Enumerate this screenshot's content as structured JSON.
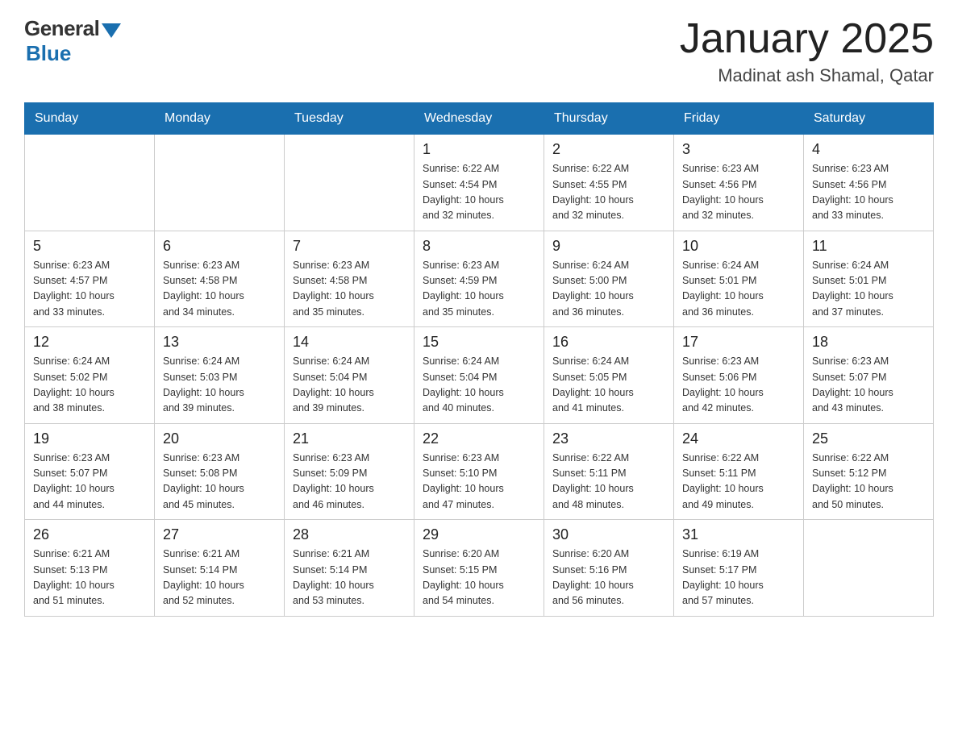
{
  "header": {
    "logo_general": "General",
    "logo_blue": "Blue",
    "month_title": "January 2025",
    "location": "Madinat ash Shamal, Qatar"
  },
  "weekdays": [
    "Sunday",
    "Monday",
    "Tuesday",
    "Wednesday",
    "Thursday",
    "Friday",
    "Saturday"
  ],
  "weeks": [
    [
      {
        "day": "",
        "info": ""
      },
      {
        "day": "",
        "info": ""
      },
      {
        "day": "",
        "info": ""
      },
      {
        "day": "1",
        "info": "Sunrise: 6:22 AM\nSunset: 4:54 PM\nDaylight: 10 hours\nand 32 minutes."
      },
      {
        "day": "2",
        "info": "Sunrise: 6:22 AM\nSunset: 4:55 PM\nDaylight: 10 hours\nand 32 minutes."
      },
      {
        "day": "3",
        "info": "Sunrise: 6:23 AM\nSunset: 4:56 PM\nDaylight: 10 hours\nand 32 minutes."
      },
      {
        "day": "4",
        "info": "Sunrise: 6:23 AM\nSunset: 4:56 PM\nDaylight: 10 hours\nand 33 minutes."
      }
    ],
    [
      {
        "day": "5",
        "info": "Sunrise: 6:23 AM\nSunset: 4:57 PM\nDaylight: 10 hours\nand 33 minutes."
      },
      {
        "day": "6",
        "info": "Sunrise: 6:23 AM\nSunset: 4:58 PM\nDaylight: 10 hours\nand 34 minutes."
      },
      {
        "day": "7",
        "info": "Sunrise: 6:23 AM\nSunset: 4:58 PM\nDaylight: 10 hours\nand 35 minutes."
      },
      {
        "day": "8",
        "info": "Sunrise: 6:23 AM\nSunset: 4:59 PM\nDaylight: 10 hours\nand 35 minutes."
      },
      {
        "day": "9",
        "info": "Sunrise: 6:24 AM\nSunset: 5:00 PM\nDaylight: 10 hours\nand 36 minutes."
      },
      {
        "day": "10",
        "info": "Sunrise: 6:24 AM\nSunset: 5:01 PM\nDaylight: 10 hours\nand 36 minutes."
      },
      {
        "day": "11",
        "info": "Sunrise: 6:24 AM\nSunset: 5:01 PM\nDaylight: 10 hours\nand 37 minutes."
      }
    ],
    [
      {
        "day": "12",
        "info": "Sunrise: 6:24 AM\nSunset: 5:02 PM\nDaylight: 10 hours\nand 38 minutes."
      },
      {
        "day": "13",
        "info": "Sunrise: 6:24 AM\nSunset: 5:03 PM\nDaylight: 10 hours\nand 39 minutes."
      },
      {
        "day": "14",
        "info": "Sunrise: 6:24 AM\nSunset: 5:04 PM\nDaylight: 10 hours\nand 39 minutes."
      },
      {
        "day": "15",
        "info": "Sunrise: 6:24 AM\nSunset: 5:04 PM\nDaylight: 10 hours\nand 40 minutes."
      },
      {
        "day": "16",
        "info": "Sunrise: 6:24 AM\nSunset: 5:05 PM\nDaylight: 10 hours\nand 41 minutes."
      },
      {
        "day": "17",
        "info": "Sunrise: 6:23 AM\nSunset: 5:06 PM\nDaylight: 10 hours\nand 42 minutes."
      },
      {
        "day": "18",
        "info": "Sunrise: 6:23 AM\nSunset: 5:07 PM\nDaylight: 10 hours\nand 43 minutes."
      }
    ],
    [
      {
        "day": "19",
        "info": "Sunrise: 6:23 AM\nSunset: 5:07 PM\nDaylight: 10 hours\nand 44 minutes."
      },
      {
        "day": "20",
        "info": "Sunrise: 6:23 AM\nSunset: 5:08 PM\nDaylight: 10 hours\nand 45 minutes."
      },
      {
        "day": "21",
        "info": "Sunrise: 6:23 AM\nSunset: 5:09 PM\nDaylight: 10 hours\nand 46 minutes."
      },
      {
        "day": "22",
        "info": "Sunrise: 6:23 AM\nSunset: 5:10 PM\nDaylight: 10 hours\nand 47 minutes."
      },
      {
        "day": "23",
        "info": "Sunrise: 6:22 AM\nSunset: 5:11 PM\nDaylight: 10 hours\nand 48 minutes."
      },
      {
        "day": "24",
        "info": "Sunrise: 6:22 AM\nSunset: 5:11 PM\nDaylight: 10 hours\nand 49 minutes."
      },
      {
        "day": "25",
        "info": "Sunrise: 6:22 AM\nSunset: 5:12 PM\nDaylight: 10 hours\nand 50 minutes."
      }
    ],
    [
      {
        "day": "26",
        "info": "Sunrise: 6:21 AM\nSunset: 5:13 PM\nDaylight: 10 hours\nand 51 minutes."
      },
      {
        "day": "27",
        "info": "Sunrise: 6:21 AM\nSunset: 5:14 PM\nDaylight: 10 hours\nand 52 minutes."
      },
      {
        "day": "28",
        "info": "Sunrise: 6:21 AM\nSunset: 5:14 PM\nDaylight: 10 hours\nand 53 minutes."
      },
      {
        "day": "29",
        "info": "Sunrise: 6:20 AM\nSunset: 5:15 PM\nDaylight: 10 hours\nand 54 minutes."
      },
      {
        "day": "30",
        "info": "Sunrise: 6:20 AM\nSunset: 5:16 PM\nDaylight: 10 hours\nand 56 minutes."
      },
      {
        "day": "31",
        "info": "Sunrise: 6:19 AM\nSunset: 5:17 PM\nDaylight: 10 hours\nand 57 minutes."
      },
      {
        "day": "",
        "info": ""
      }
    ]
  ]
}
